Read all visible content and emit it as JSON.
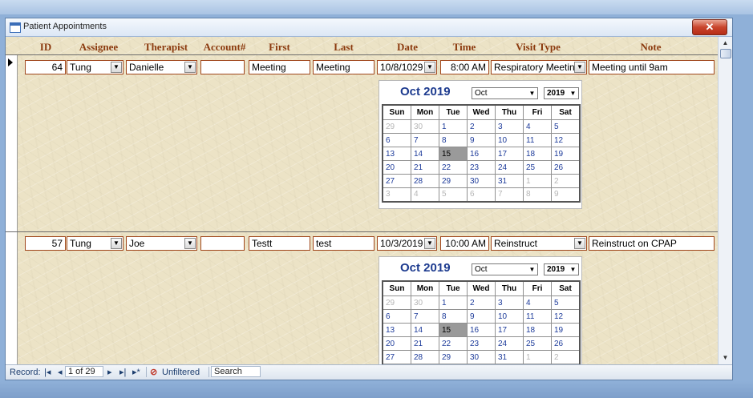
{
  "window": {
    "title": "Patient Appointments",
    "close_glyph": "✕"
  },
  "columns": {
    "id": "ID",
    "assignee": "Assignee",
    "therapist": "Therapist",
    "account": "Account#",
    "first": "First",
    "last": "Last",
    "date": "Date",
    "time": "Time",
    "visit_type": "Visit Type",
    "note": "Note"
  },
  "records": [
    {
      "id": "64",
      "assignee": "Tung",
      "therapist": "Danielle",
      "account": "",
      "first": "Meeting",
      "last": "Meeting",
      "date": "10/8/1029",
      "time": "8:00 AM",
      "visit_type": "Respiratory Meetin",
      "note": "Meeting until 9am"
    },
    {
      "id": "57",
      "assignee": "Tung",
      "therapist": "Joe",
      "account": "",
      "first": "Testt",
      "last": "test",
      "date": "10/3/2019",
      "time": "10:00 AM",
      "visit_type": "Reinstruct",
      "note": "Reinstruct on CPAP"
    }
  ],
  "calendar": {
    "title": "Oct 2019",
    "month_select": "Oct",
    "year_select": "2019",
    "weekdays": [
      "Sun",
      "Mon",
      "Tue",
      "Wed",
      "Thu",
      "Fri",
      "Sat"
    ],
    "weeks": [
      [
        "29",
        "30",
        "1",
        "2",
        "3",
        "4",
        "5"
      ],
      [
        "6",
        "7",
        "8",
        "9",
        "10",
        "11",
        "12"
      ],
      [
        "13",
        "14",
        "15",
        "16",
        "17",
        "18",
        "19"
      ],
      [
        "20",
        "21",
        "22",
        "23",
        "24",
        "25",
        "26"
      ],
      [
        "27",
        "28",
        "29",
        "30",
        "31",
        "1",
        "2"
      ],
      [
        "3",
        "4",
        "5",
        "6",
        "7",
        "8",
        "9"
      ]
    ],
    "highlighted_day": "15"
  },
  "navigation": {
    "record_label": "Record:",
    "first_glyph": "|◂",
    "prev_glyph": "◂",
    "position": "1 of 29",
    "next_glyph": "▸",
    "last_glyph": "▸|",
    "new_glyph": "▸*",
    "filter_icon": "filter-off-icon",
    "filter_label": "Unfiltered",
    "search_placeholder": "Search"
  },
  "colors": {
    "header_text": "#8b3a0e",
    "field_border": "#a0461b",
    "calendar_title": "#1d3b8f",
    "day_text": "#1d3b9a",
    "close_button": "#c9452c"
  }
}
